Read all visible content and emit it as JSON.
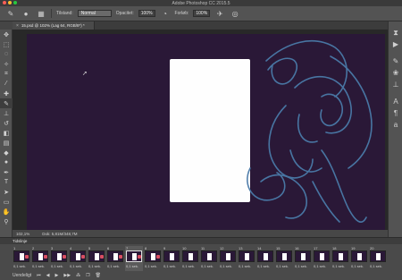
{
  "window": {
    "title": "Adobe Photoshop CC 2015.5"
  },
  "options_bar": {
    "blend_mode_label": "Tilstand:",
    "blend_mode_value": "Normal",
    "opacity_label": "Opacitet:",
    "opacity_value": "100%",
    "flow_label": "Forløb:",
    "flow_value": "100%"
  },
  "document_tab": {
    "title": "15.psd @ 102% (Lag 64, RGB/8*) *"
  },
  "status_bar": {
    "zoom": "102,1%",
    "doc_info": "Dok: 5,81M/348,7M"
  },
  "timeline": {
    "title": "Tidslinje",
    "loop_option": "Uendeligt",
    "selected_frame": 7,
    "frame_duration": "0,1 sek.",
    "frames": [
      "1",
      "2",
      "3",
      "4",
      "5",
      "6",
      "7",
      "8",
      "9",
      "10",
      "11",
      "12",
      "13",
      "14",
      "15",
      "16",
      "17",
      "18",
      "19",
      "20"
    ]
  },
  "colors": {
    "foreground": "#5dc6f3",
    "background": "#ffffff",
    "canvas": "#2a1837",
    "sketch_stroke": "#4a7aa8"
  }
}
